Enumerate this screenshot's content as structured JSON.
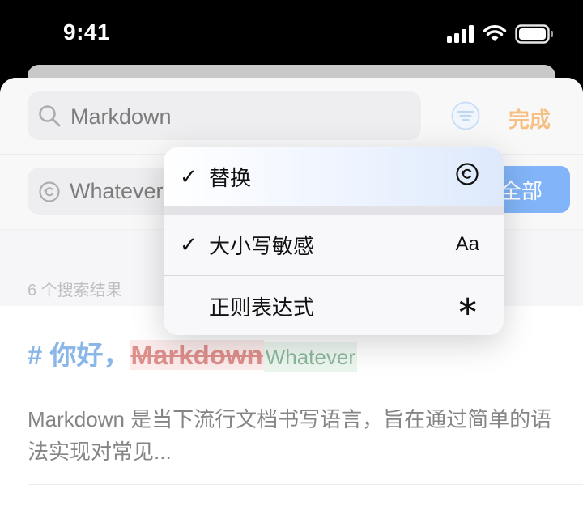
{
  "status_bar": {
    "time": "9:41"
  },
  "search": {
    "value": "Markdown"
  },
  "toolbar": {
    "done_label": "完成"
  },
  "replace": {
    "value": "Whatever",
    "replace_all_label": "全部"
  },
  "results": {
    "count_label": "6 个搜索结果",
    "items": [
      {
        "heading_prefix": "# 你好，",
        "match_deleted": "Markdown",
        "match_inserted": "Whatever",
        "description": "Markdown 是当下流行文档书写语言，旨在通过简单的语法实现对常见..."
      }
    ]
  },
  "menu": {
    "items": [
      {
        "check": "✓",
        "label": "替换",
        "icon": "replace-icon",
        "checked": true
      },
      {
        "check": "✓",
        "label": "大小写敏感",
        "right_text": "Aa",
        "checked": true
      },
      {
        "check": "",
        "label": "正则表达式",
        "right_text": "∗",
        "checked": false
      }
    ]
  },
  "colors": {
    "accent_orange": "#f08a1b",
    "button_blue": "#1a77f2",
    "heading_blue": "#2a7ad6",
    "deleted_red": "#c2332e",
    "inserted_green": "#2f7d4a"
  }
}
